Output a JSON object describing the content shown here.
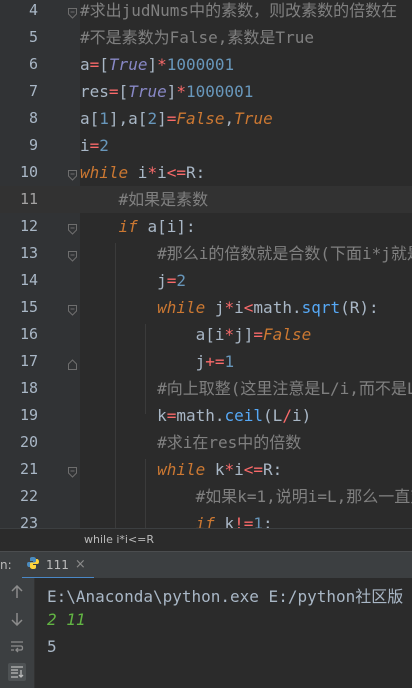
{
  "editor": {
    "lines": [
      {
        "n": "4",
        "segs": [
          [
            "cmt",
            "#求出judNums中的素数，则改素数的倍数在"
          ]
        ]
      },
      {
        "n": "5",
        "segs": [
          [
            "cmt",
            "#不是素数为False,素数是True"
          ]
        ]
      },
      {
        "n": "6",
        "segs": [
          [
            "",
            "a"
          ],
          [
            "op",
            "="
          ],
          [
            "",
            "["
          ],
          [
            "cst",
            "True"
          ],
          [
            "",
            "]"
          ],
          [
            "op",
            "*"
          ],
          [
            "num",
            "1000001"
          ]
        ]
      },
      {
        "n": "7",
        "segs": [
          [
            "",
            "res"
          ],
          [
            "op",
            "="
          ],
          [
            "",
            "["
          ],
          [
            "cst",
            "True"
          ],
          [
            "",
            "]"
          ],
          [
            "op",
            "*"
          ],
          [
            "num",
            "1000001"
          ]
        ]
      },
      {
        "n": "8",
        "segs": [
          [
            "",
            "a["
          ],
          [
            "num",
            "1"
          ],
          [
            "",
            "],a["
          ],
          [
            "num",
            "2"
          ],
          [
            "",
            "]"
          ],
          [
            "op",
            "="
          ],
          [
            "kwi",
            "False"
          ],
          [
            "",
            ","
          ],
          [
            "kwi",
            "True"
          ]
        ]
      },
      {
        "n": "9",
        "segs": [
          [
            "",
            "i"
          ],
          [
            "op",
            "="
          ],
          [
            "num",
            "2"
          ]
        ]
      },
      {
        "n": "10",
        "segs": [
          [
            "kw",
            "while "
          ],
          [
            "",
            "i"
          ],
          [
            "op",
            "*"
          ],
          [
            "",
            "i"
          ],
          [
            "op",
            "<="
          ],
          [
            "",
            "R:"
          ]
        ]
      },
      {
        "n": "11",
        "segs": [
          [
            "",
            "    "
          ],
          [
            "cmt",
            "#如果是素数"
          ]
        ]
      },
      {
        "n": "12",
        "segs": [
          [
            "",
            "    "
          ],
          [
            "kw",
            "if "
          ],
          [
            "",
            "a[i]:"
          ]
        ]
      },
      {
        "n": "13",
        "segs": [
          [
            "",
            "        "
          ],
          [
            "cmt",
            "#那么i的倍数就是合数(下面i*j就是"
          ]
        ]
      },
      {
        "n": "14",
        "segs": [
          [
            "",
            "        j"
          ],
          [
            "op",
            "="
          ],
          [
            "num",
            "2"
          ]
        ]
      },
      {
        "n": "15",
        "segs": [
          [
            "",
            "        "
          ],
          [
            "kw",
            "while "
          ],
          [
            "",
            "j"
          ],
          [
            "op",
            "*"
          ],
          [
            "",
            "i"
          ],
          [
            "op",
            "<"
          ],
          [
            "",
            "math."
          ],
          [
            "fn",
            "sqrt"
          ],
          [
            "",
            "(R):"
          ]
        ]
      },
      {
        "n": "16",
        "segs": [
          [
            "",
            "            a[i"
          ],
          [
            "op",
            "*"
          ],
          [
            "",
            "j]"
          ],
          [
            "op",
            "="
          ],
          [
            "kwi",
            "False"
          ]
        ]
      },
      {
        "n": "17",
        "segs": [
          [
            "",
            "            j"
          ],
          [
            "op",
            "+="
          ],
          [
            "num",
            "1"
          ]
        ]
      },
      {
        "n": "18",
        "segs": [
          [
            "",
            "        "
          ],
          [
            "cmt",
            "#向上取整(这里注意是L/i,而不是L"
          ]
        ]
      },
      {
        "n": "19",
        "segs": [
          [
            "",
            "        k"
          ],
          [
            "op",
            "="
          ],
          [
            "",
            "math."
          ],
          [
            "fn",
            "ceil"
          ],
          [
            "",
            "(L"
          ],
          [
            "op",
            "/"
          ],
          [
            "",
            "i)"
          ]
        ]
      },
      {
        "n": "20",
        "segs": [
          [
            "",
            "        "
          ],
          [
            "cmt",
            "#求i在res中的倍数"
          ]
        ]
      },
      {
        "n": "21",
        "segs": [
          [
            "",
            "        "
          ],
          [
            "kw",
            "while "
          ],
          [
            "",
            "k"
          ],
          [
            "op",
            "*"
          ],
          [
            "",
            "i"
          ],
          [
            "op",
            "<="
          ],
          [
            "",
            "R:"
          ]
        ]
      },
      {
        "n": "22",
        "segs": [
          [
            "",
            "            "
          ],
          [
            "cmt",
            "#如果k=1,说明i=L,那么一直对"
          ]
        ]
      },
      {
        "n": "23",
        "segs": [
          [
            "",
            "            "
          ],
          [
            "kw",
            "if "
          ],
          [
            "",
            "k"
          ],
          [
            "op",
            "!="
          ],
          [
            "num",
            "1"
          ],
          [
            "",
            ":"
          ]
        ]
      }
    ],
    "current_line": "11"
  },
  "breadcrumb": {
    "text": "while i*i<=R"
  },
  "run": {
    "prefix": "n:",
    "tab_label": "111",
    "tab_close": "×"
  },
  "console": {
    "command": "E:\\Anaconda\\python.exe E:/python社区版",
    "input": "2 11",
    "result": "5"
  },
  "colors": {
    "keyword": "#cc7832",
    "operator": "#f96a6a",
    "comment": "#808080",
    "number": "#6897bb",
    "input_green": "#62b543"
  }
}
